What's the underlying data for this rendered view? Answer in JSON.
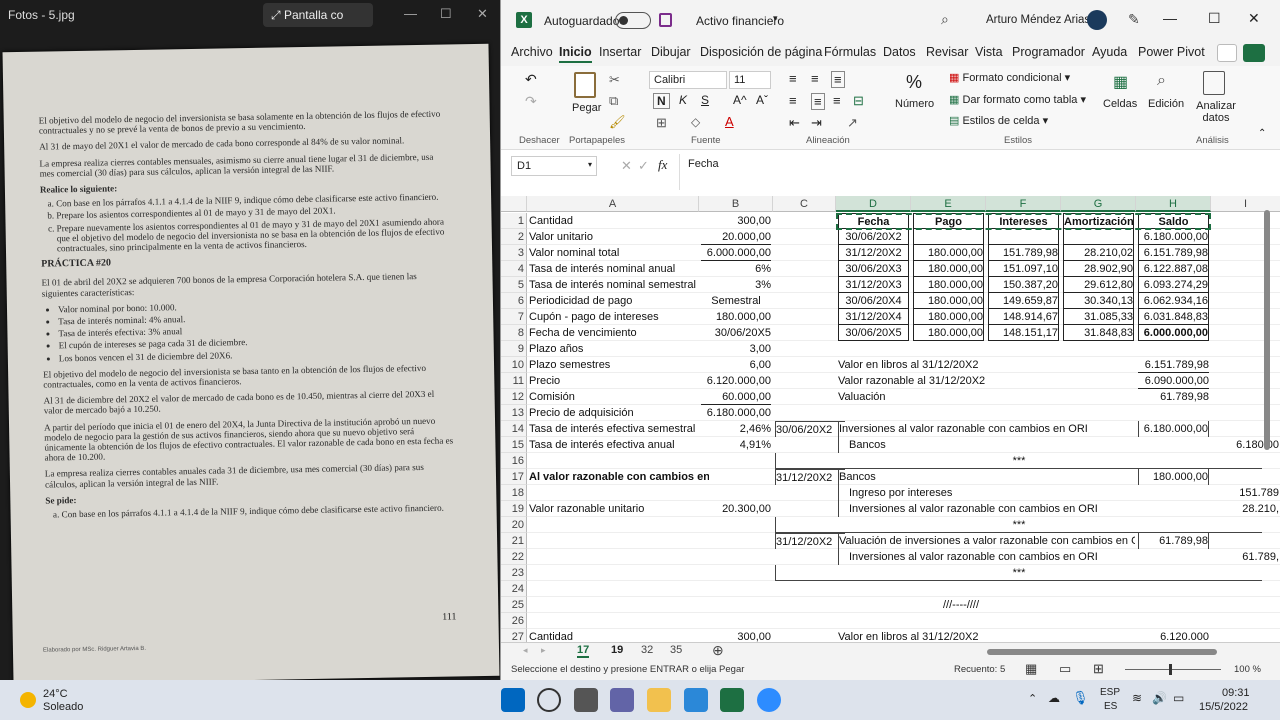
{
  "photos": {
    "title": "Fotos - 5.jpg",
    "snip_label": "Pantalla co",
    "doc_paragraphs": [
      "El objetivo del modelo de negocio del inversionista se basa solamente en la obtención de los flujos de efectivo contractuales y no se prevé la venta de bonos de previo a su vencimiento.",
      "Al 31 de mayo del 20X1 el valor de mercado de cada bono corresponde al 84% de su valor nominal.",
      "La empresa realiza cierres contables mensuales, asimismo su cierre anual tiene lugar el 31 de diciembre, usa mes comercial (30 días) para sus cálculos, aplican la versión integral de las NIIF."
    ],
    "doc_subhead": "Realice lo siguiente:",
    "doc_items": [
      "Con base en los párrafos 4.1.1 a 4.1.4 de la NIIF 9, indique cómo debe clasificarse este activo financiero.",
      "Prepare los asientos correspondientes al 01 de mayo y 31 de mayo del 20X1.",
      "Prepare nuevamente los asientos correspondientes al 01 de mayo y 31 de mayo del 20X1 asumiendo ahora que el objetivo del modelo de negocio del inversionista no se basa en la obtención de los flujos de efectivo contractuales, sino principalmente en la venta de activos financieros."
    ],
    "doc_practice": "PRÁCTICA #20",
    "doc_para2": "El 01 de abril del 20X2 se adquieren 700 bonos de la empresa Corporación hotelera S.A. que tienen las siguientes características:",
    "doc_bullets": [
      "Valor nominal por bono: 10.000.",
      "Tasa de interés nominal: 4% anual.",
      "Tasa de interés efectiva: 3% anual",
      "El cupón de intereses se paga cada 31 de diciembre.",
      "Los bonos vencen el 31 de diciembre del 20X6."
    ],
    "doc_paragraphs2": [
      "El objetivo del modelo de negocio del inversionista se basa tanto en la obtención de los flujos de efectivo contractuales, como en la venta de activos financieros.",
      "Al 31 de diciembre del 20X2 el valor de mercado de cada bono es de 10.450, mientras al cierre del 20X3 el valor de mercado bajó a 10.250.",
      "A partir del período que inicia el 01 de enero del 20X4, la Junta Directiva de la institución aprobó un nuevo modelo de negocio para la gestión de sus activos financieros, siendo ahora que su nuevo objetivo será únicamente la obtención de los flujos de efectivo contractuales. El valor razonable de cada bono en esta fecha es ahora de 10.200.",
      "La empresa realiza cierres contables anuales cada 31 de diciembre, usa mes comercial (30 días) para sus cálculos, aplican la versión integral de las NIIF."
    ],
    "doc_sepide": "Se pide:",
    "doc_final": "Con base en los párrafos 4.1.1 a 4.1.4 de la NIIF 9, indique cómo debe clasificarse este activo financiero.",
    "doc_page": "111",
    "doc_footer": "Elaborado por MSc. Ridguer Artavia B."
  },
  "excel": {
    "autosave": "Autoguardado",
    "filename": "Activo financiero",
    "user": "Arturo Méndez Arias",
    "menu": [
      "Archivo",
      "Inicio",
      "Insertar",
      "Dibujar",
      "Disposición de página",
      "Fórmulas",
      "Datos",
      "Revisar",
      "Vista",
      "Programador",
      "Ayuda",
      "Power Pivot"
    ],
    "ribbon": {
      "font": "Calibri",
      "size": "11",
      "paste": "Pegar",
      "number": "Número",
      "cond": "Formato condicional",
      "table": "Dar formato como tabla",
      "styles": "Estilos de celda",
      "cells": "Celdas",
      "edit": "Edición",
      "analyze": "Analizar datos",
      "groups": [
        "Deshacer",
        "Portapapeles",
        "Fuente",
        "Alineación",
        "Estilos",
        "Análisis"
      ]
    },
    "namebox": "D1",
    "formula": "Fecha",
    "columns": [
      "A",
      "B",
      "C",
      "D",
      "E",
      "F",
      "G",
      "H",
      "I"
    ],
    "rows": [
      "1",
      "2",
      "3",
      "4",
      "5",
      "6",
      "7",
      "8",
      "9",
      "10",
      "11",
      "12",
      "13",
      "14",
      "15",
      "16",
      "17",
      "18",
      "19",
      "20",
      "21",
      "22",
      "23",
      "24",
      "25",
      "26",
      "27"
    ],
    "colA": [
      "Cantidad",
      "Valor unitario",
      "Valor nominal total",
      "Tasa de interés nominal anual",
      "Tasa de interés nominal semestral",
      "Periodicidad de pago",
      "Cupón - pago de intereses",
      "Fecha de vencimiento",
      "Plazo años",
      "Plazo semestres",
      "Precio",
      "Comisión",
      "Precio de adquisición",
      "Tasa de interés efectiva semestral",
      "Tasa de interés efectiva anual",
      "",
      "Al valor razonable con cambios en ORI",
      "",
      "Valor razonable unitario",
      "",
      "",
      "",
      "",
      "",
      "",
      "",
      "Cantidad"
    ],
    "colB": [
      "300,00",
      "20.000,00",
      "6.000.000,00",
      "6%",
      "3%",
      "Semestral",
      "180.000,00",
      "30/06/20X5",
      "3,00",
      "6,00",
      "6.120.000,00",
      "60.000,00",
      "6.180.000,00",
      "2,46%",
      "4,91%",
      "",
      "",
      "",
      "20.300,00",
      "",
      "",
      "",
      "",
      "",
      "",
      "",
      "300,00"
    ],
    "table_headers": [
      "Fecha",
      "Pago",
      "Intereses",
      "Amortización",
      "Saldo"
    ],
    "table_rows": [
      [
        "30/06/20X2",
        "",
        "",
        "",
        "6.180.000,00"
      ],
      [
        "31/12/20X2",
        "180.000,00",
        "151.789,98",
        "28.210,02",
        "6.151.789,98"
      ],
      [
        "30/06/20X3",
        "180.000,00",
        "151.097,10",
        "28.902,90",
        "6.122.887,08"
      ],
      [
        "31/12/20X3",
        "180.000,00",
        "150.387,20",
        "29.612,80",
        "6.093.274,29"
      ],
      [
        "30/06/20X4",
        "180.000,00",
        "149.659,87",
        "30.340,13",
        "6.062.934,16"
      ],
      [
        "31/12/20X4",
        "180.000,00",
        "148.914,67",
        "31.085,33",
        "6.031.848,83"
      ],
      [
        "30/06/20X5",
        "180.000,00",
        "148.151,17",
        "31.848,83",
        "6.000.000,00"
      ]
    ],
    "summary": [
      {
        "label": "Valor en libros al 31/12/20X2",
        "value": "6.151.789,98"
      },
      {
        "label": "Valor razonable al 31/12/20X2",
        "value": "6.090.000,00"
      },
      {
        "label": "Valuación",
        "value": "61.789,98"
      }
    ],
    "journal": [
      {
        "date": "30/06/20X2",
        "desc": "Inversiones al valor razonable con cambios en ORI",
        "debit": "6.180.000,00",
        "credit": ""
      },
      {
        "date": "",
        "desc": "Bancos",
        "debit": "",
        "credit": "6.180.00"
      },
      {
        "date": "",
        "desc": "***",
        "debit": "",
        "credit": ""
      },
      {
        "date": "31/12/20X2",
        "desc": "Bancos",
        "debit": "180.000,00",
        "credit": ""
      },
      {
        "date": "",
        "desc": "Ingreso por intereses",
        "debit": "",
        "credit": "151.789"
      },
      {
        "date": "",
        "desc": "Inversiones al valor razonable con cambios en ORI",
        "debit": "",
        "credit": "28.210,"
      },
      {
        "date": "",
        "desc": "***",
        "debit": "",
        "credit": ""
      },
      {
        "date": "31/12/20X2",
        "desc": "Valuación de inversiones a valor razonable con cambios en O",
        "debit": "61.789,98",
        "credit": ""
      },
      {
        "date": "",
        "desc": "Inversiones al valor razonable con cambios en ORI",
        "debit": "",
        "credit": "61.789,"
      },
      {
        "date": "",
        "desc": "***",
        "debit": "",
        "credit": ""
      }
    ],
    "row25": "///----////",
    "row27_label": "Valor en libros al 31/12/20X2",
    "row27_value": "6.120.000",
    "sheets": [
      "17",
      "19",
      "32",
      "35"
    ],
    "status_left": "Seleccione el destino y presione ENTRAR o elija Pegar",
    "status_count": "Recuento: 5",
    "zoom": "100 %"
  },
  "taskbar": {
    "temp": "24°C",
    "weather": "Soleado",
    "lang1": "ESP",
    "lang2": "ES",
    "time": "09:31",
    "date": "15/5/2022"
  }
}
